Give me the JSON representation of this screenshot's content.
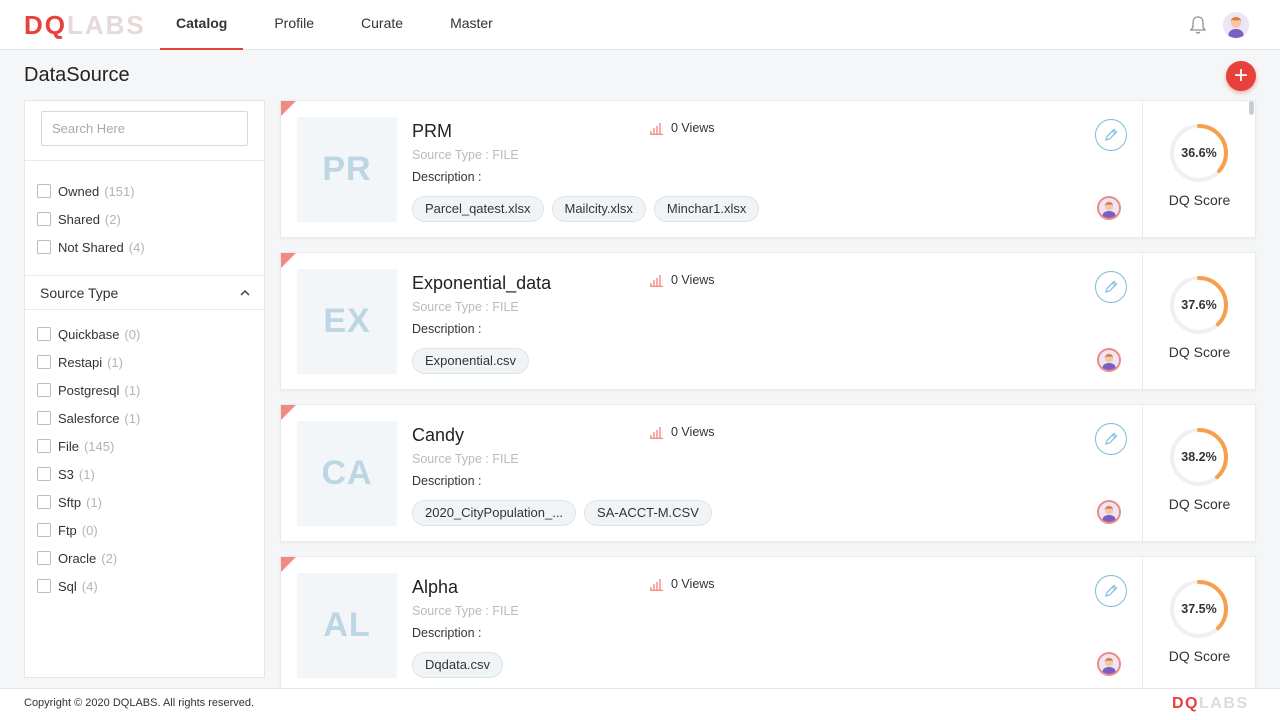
{
  "brand": {
    "dq": "DQ",
    "labs": "LABS"
  },
  "nav": [
    {
      "label": "Catalog",
      "active": true
    },
    {
      "label": "Profile"
    },
    {
      "label": "Curate"
    },
    {
      "label": "Master"
    }
  ],
  "page": {
    "title": "DataSource",
    "add_label": "+"
  },
  "sidebar": {
    "search_placeholder": "Search Here",
    "ownership": [
      {
        "label": "Owned",
        "count": "(151)"
      },
      {
        "label": "Shared",
        "count": "(2)"
      },
      {
        "label": "Not Shared",
        "count": "(4)"
      }
    ],
    "source_type_heading": "Source Type",
    "source_types": [
      {
        "label": "Quickbase",
        "count": "(0)"
      },
      {
        "label": "Restapi",
        "count": "(1)"
      },
      {
        "label": "Postgresql",
        "count": "(1)"
      },
      {
        "label": "Salesforce",
        "count": "(1)"
      },
      {
        "label": "File",
        "count": "(145)"
      },
      {
        "label": "S3",
        "count": "(1)"
      },
      {
        "label": "Sftp",
        "count": "(1)"
      },
      {
        "label": "Ftp",
        "count": "(0)"
      },
      {
        "label": "Oracle",
        "count": "(2)"
      },
      {
        "label": "Sql",
        "count": "(4)"
      }
    ]
  },
  "cards": [
    {
      "initials": "PR",
      "title": "PRM",
      "source_type": "Source Type : FILE",
      "description": "Description :",
      "views": "0 Views",
      "tags": [
        "Parcel_qatest.xlsx",
        "Mailcity.xlsx",
        "Minchar1.xlsx"
      ],
      "score": 36.6,
      "score_text": "36.6%",
      "score_label": "DQ Score"
    },
    {
      "initials": "EX",
      "title": "Exponential_data",
      "source_type": "Source Type : FILE",
      "description": "Description :",
      "views": "0 Views",
      "tags": [
        "Exponential.csv"
      ],
      "score": 37.6,
      "score_text": "37.6%",
      "score_label": "DQ Score"
    },
    {
      "initials": "CA",
      "title": "Candy",
      "source_type": "Source Type : FILE",
      "description": "Description :",
      "views": "0 Views",
      "tags": [
        "2020_CityPopulation_...",
        "SA-ACCT-M.CSV"
      ],
      "score": 38.2,
      "score_text": "38.2%",
      "score_label": "DQ Score"
    },
    {
      "initials": "AL",
      "title": "Alpha",
      "source_type": "Source Type : FILE",
      "description": "Description :",
      "views": "0 Views",
      "tags": [
        "Dqdata.csv"
      ],
      "score": 37.5,
      "score_text": "37.5%",
      "score_label": "DQ Score"
    }
  ],
  "footer": {
    "copyright": "Copyright © 2020 DQLABS. All rights reserved."
  },
  "colors": {
    "accent": "#e8403a",
    "score_ring": "#f7a04b",
    "score_track": "#eef0f1",
    "icon_blue": "#7dbcd9"
  },
  "icons": {
    "notifications": "bell-icon",
    "edit": "pencil-icon",
    "views": "bar-chart-icon",
    "collapse": "chevron-up-icon"
  }
}
